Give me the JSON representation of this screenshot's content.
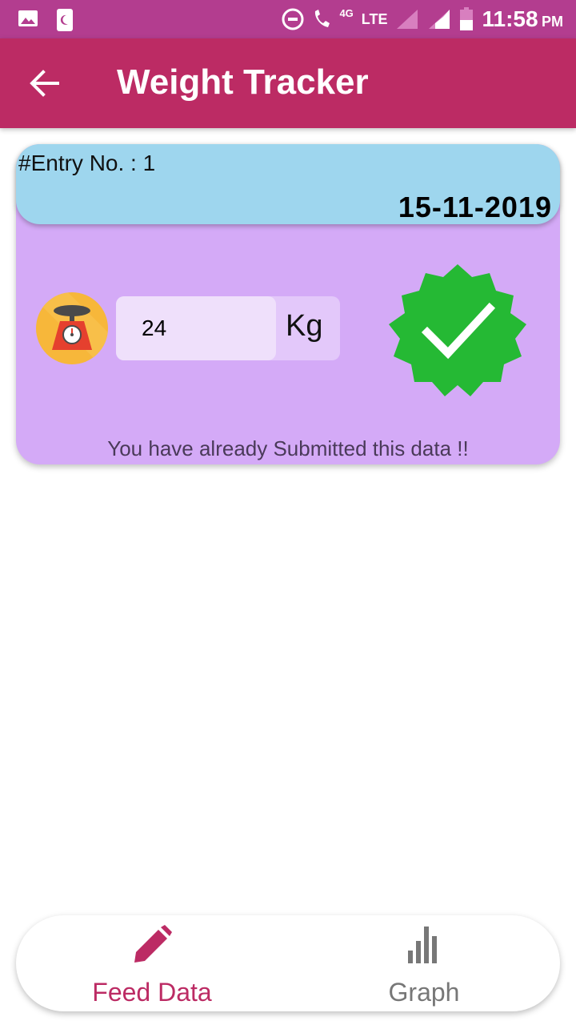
{
  "status_bar": {
    "network_4g": "4G",
    "network_lte": "LTE",
    "time": "11:58",
    "ampm": "PM"
  },
  "app_bar": {
    "title": "Weight Tracker"
  },
  "entry_card": {
    "entry_label": "#Entry No. : 1",
    "date": "15-11-2019",
    "weight_value": "24",
    "weight_unit": "Kg",
    "status_message": "You have already Submitted this data !!"
  },
  "bottom_nav": {
    "items": [
      {
        "label": "Feed Data",
        "icon": "pencil-icon",
        "active": true
      },
      {
        "label": "Graph",
        "icon": "bar-chart-icon",
        "active": false
      }
    ]
  },
  "colors": {
    "status_bar": "#b33d8f",
    "app_bar": "#bc2b64",
    "card_body": "#d4aaf7",
    "card_header": "#9ed6ee",
    "check_badge": "#25b934",
    "active_nav": "#bc2b64",
    "inactive_nav": "#777777"
  }
}
